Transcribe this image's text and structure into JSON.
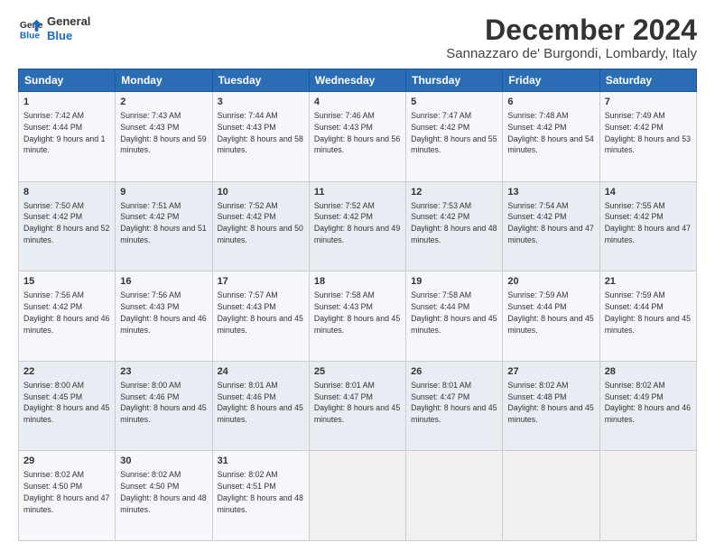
{
  "logo": {
    "line1": "General",
    "line2": "Blue"
  },
  "title": "December 2024",
  "location": "Sannazzaro de' Burgondi, Lombardy, Italy",
  "days_header": [
    "Sunday",
    "Monday",
    "Tuesday",
    "Wednesday",
    "Thursday",
    "Friday",
    "Saturday"
  ],
  "weeks": [
    [
      {
        "day": "1",
        "sunrise": "7:42 AM",
        "sunset": "4:44 PM",
        "daylight": "9 hours and 1 minute."
      },
      {
        "day": "2",
        "sunrise": "7:43 AM",
        "sunset": "4:43 PM",
        "daylight": "8 hours and 59 minutes."
      },
      {
        "day": "3",
        "sunrise": "7:44 AM",
        "sunset": "4:43 PM",
        "daylight": "8 hours and 58 minutes."
      },
      {
        "day": "4",
        "sunrise": "7:46 AM",
        "sunset": "4:43 PM",
        "daylight": "8 hours and 56 minutes."
      },
      {
        "day": "5",
        "sunrise": "7:47 AM",
        "sunset": "4:42 PM",
        "daylight": "8 hours and 55 minutes."
      },
      {
        "day": "6",
        "sunrise": "7:48 AM",
        "sunset": "4:42 PM",
        "daylight": "8 hours and 54 minutes."
      },
      {
        "day": "7",
        "sunrise": "7:49 AM",
        "sunset": "4:42 PM",
        "daylight": "8 hours and 53 minutes."
      }
    ],
    [
      {
        "day": "8",
        "sunrise": "7:50 AM",
        "sunset": "4:42 PM",
        "daylight": "8 hours and 52 minutes."
      },
      {
        "day": "9",
        "sunrise": "7:51 AM",
        "sunset": "4:42 PM",
        "daylight": "8 hours and 51 minutes."
      },
      {
        "day": "10",
        "sunrise": "7:52 AM",
        "sunset": "4:42 PM",
        "daylight": "8 hours and 50 minutes."
      },
      {
        "day": "11",
        "sunrise": "7:52 AM",
        "sunset": "4:42 PM",
        "daylight": "8 hours and 49 minutes."
      },
      {
        "day": "12",
        "sunrise": "7:53 AM",
        "sunset": "4:42 PM",
        "daylight": "8 hours and 48 minutes."
      },
      {
        "day": "13",
        "sunrise": "7:54 AM",
        "sunset": "4:42 PM",
        "daylight": "8 hours and 47 minutes."
      },
      {
        "day": "14",
        "sunrise": "7:55 AM",
        "sunset": "4:42 PM",
        "daylight": "8 hours and 47 minutes."
      }
    ],
    [
      {
        "day": "15",
        "sunrise": "7:56 AM",
        "sunset": "4:42 PM",
        "daylight": "8 hours and 46 minutes."
      },
      {
        "day": "16",
        "sunrise": "7:56 AM",
        "sunset": "4:43 PM",
        "daylight": "8 hours and 46 minutes."
      },
      {
        "day": "17",
        "sunrise": "7:57 AM",
        "sunset": "4:43 PM",
        "daylight": "8 hours and 45 minutes."
      },
      {
        "day": "18",
        "sunrise": "7:58 AM",
        "sunset": "4:43 PM",
        "daylight": "8 hours and 45 minutes."
      },
      {
        "day": "19",
        "sunrise": "7:58 AM",
        "sunset": "4:44 PM",
        "daylight": "8 hours and 45 minutes."
      },
      {
        "day": "20",
        "sunrise": "7:59 AM",
        "sunset": "4:44 PM",
        "daylight": "8 hours and 45 minutes."
      },
      {
        "day": "21",
        "sunrise": "7:59 AM",
        "sunset": "4:44 PM",
        "daylight": "8 hours and 45 minutes."
      }
    ],
    [
      {
        "day": "22",
        "sunrise": "8:00 AM",
        "sunset": "4:45 PM",
        "daylight": "8 hours and 45 minutes."
      },
      {
        "day": "23",
        "sunrise": "8:00 AM",
        "sunset": "4:46 PM",
        "daylight": "8 hours and 45 minutes."
      },
      {
        "day": "24",
        "sunrise": "8:01 AM",
        "sunset": "4:46 PM",
        "daylight": "8 hours and 45 minutes."
      },
      {
        "day": "25",
        "sunrise": "8:01 AM",
        "sunset": "4:47 PM",
        "daylight": "8 hours and 45 minutes."
      },
      {
        "day": "26",
        "sunrise": "8:01 AM",
        "sunset": "4:47 PM",
        "daylight": "8 hours and 45 minutes."
      },
      {
        "day": "27",
        "sunrise": "8:02 AM",
        "sunset": "4:48 PM",
        "daylight": "8 hours and 45 minutes."
      },
      {
        "day": "28",
        "sunrise": "8:02 AM",
        "sunset": "4:49 PM",
        "daylight": "8 hours and 46 minutes."
      }
    ],
    [
      {
        "day": "29",
        "sunrise": "8:02 AM",
        "sunset": "4:50 PM",
        "daylight": "8 hours and 47 minutes."
      },
      {
        "day": "30",
        "sunrise": "8:02 AM",
        "sunset": "4:50 PM",
        "daylight": "8 hours and 48 minutes."
      },
      {
        "day": "31",
        "sunrise": "8:02 AM",
        "sunset": "4:51 PM",
        "daylight": "8 hours and 48 minutes."
      },
      null,
      null,
      null,
      null
    ]
  ]
}
